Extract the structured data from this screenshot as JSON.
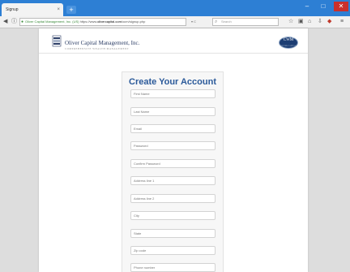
{
  "browser": {
    "tab_title": "Signup",
    "tab_close": "×",
    "new_tab": "+",
    "window_controls": {
      "minimize": "–",
      "maximize": "□",
      "close": "✕"
    },
    "url": {
      "lock_icon": "lock-icon",
      "identity": "Oliver Capital Management, Inc. (US)",
      "prefix": "https://www.",
      "domain": "olivercapital.com",
      "path": "/ocm/signup.php"
    },
    "url_controls": "▾ C",
    "search_placeholder": "Search",
    "nav_icons": [
      "back-icon",
      "info-icon",
      "star-icon",
      "clipboard-icon",
      "home-icon",
      "pocket-icon",
      "extension-icon",
      "menu-icon"
    ]
  },
  "header": {
    "brand_name": "Oliver Capital Management, Inc.",
    "tagline": "COMPREHENSIVE WEALTH MANAGEMENT",
    "badge": "CWM",
    "badge_sub": "OLIVER CAPITAL"
  },
  "form": {
    "title": "Create Your Account",
    "fields": [
      "First Name",
      "Last Name",
      "Email",
      "Password",
      "Confirm Password",
      "Address line 1",
      "Address line 2",
      "City",
      "State",
      "Zip code",
      "Phone number"
    ]
  }
}
